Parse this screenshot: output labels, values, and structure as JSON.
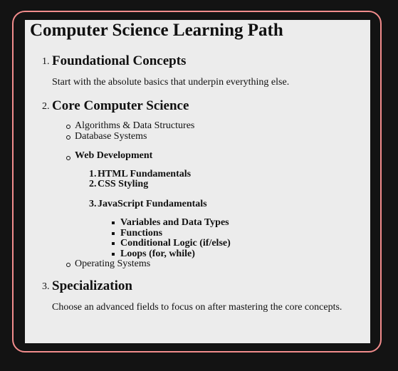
{
  "page_title": "Computer Science Learning Path",
  "sections": [
    {
      "number": "1.",
      "title": "Foundational Concepts",
      "description": "Start with the absolute basics that underpin everything else."
    },
    {
      "number": "2.",
      "title": "Core Computer Science",
      "items": [
        "Algorithms & Data Structures",
        "Database Systems",
        "Web Development",
        "Operating Systems"
      ],
      "web_development": {
        "items": [
          {
            "number": "1.",
            "label": "HTML Fundamentals"
          },
          {
            "number": "2.",
            "label": "CSS Styling"
          },
          {
            "number": "3.",
            "label": "JavaScript Fundamentals"
          }
        ],
        "javascript_topics": [
          "Variables and Data Types",
          "Functions",
          "Conditional Logic (if/else)",
          "Loops (for, while)"
        ]
      }
    },
    {
      "number": "3.",
      "title": "Specialization",
      "description": "Choose an advanced fields to focus on after mastering the core concepts."
    }
  ],
  "colors": {
    "background": "#131313",
    "frame_border": "#f28c8c",
    "paper": "#ececec",
    "text": "#111111"
  }
}
